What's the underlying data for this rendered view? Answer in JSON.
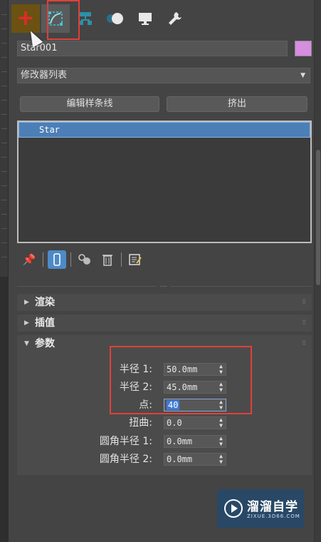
{
  "toolbar": {
    "tabs": [
      {
        "icon": "plus-icon",
        "label": "+"
      },
      {
        "icon": "modify-curve-icon"
      },
      {
        "icon": "hierarchy-icon"
      },
      {
        "icon": "motion-icon"
      },
      {
        "icon": "display-icon"
      },
      {
        "icon": "utilities-wrench-icon"
      }
    ]
  },
  "object": {
    "name": "Star001",
    "color": "#d78de0"
  },
  "modifier_list": {
    "label": "修改器列表"
  },
  "buttons": {
    "edit_spline": "编辑样条线",
    "extrude": "挤出"
  },
  "stack": {
    "items": [
      "Star"
    ]
  },
  "rollouts": {
    "render": "渲染",
    "interpolation": "插值",
    "parameters": "参数"
  },
  "params": {
    "radius1": {
      "label": "半径 1:",
      "value": "50.0mm"
    },
    "radius2": {
      "label": "半径 2:",
      "value": "45.0mm"
    },
    "points": {
      "label": "点:",
      "value": "40"
    },
    "distortion": {
      "label": "扭曲:",
      "value": "0.0"
    },
    "fillet1": {
      "label": "圆角半径 1:",
      "value": "0.0mm"
    },
    "fillet2": {
      "label": "圆角半径 2:",
      "value": "0.0mm"
    }
  },
  "watermark": {
    "cn": "溜溜自学",
    "en": "ZIXUE.3D66.COM"
  },
  "colors": {
    "panel_bg": "#444444",
    "highlight": "#e0403a",
    "selection": "#4c7fb6"
  }
}
